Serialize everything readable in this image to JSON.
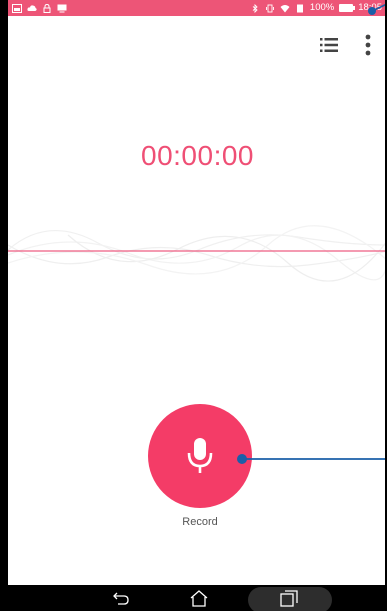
{
  "status_bar": {
    "battery_text": "100%",
    "time": "18:05",
    "color": "#ed5577",
    "icons_left": [
      "gallery-icon",
      "cloud-upload-icon",
      "lock-icon",
      "screen-cast-icon"
    ],
    "icons_right": [
      "bluetooth-icon",
      "vibrate-icon",
      "wifi-icon",
      "battery-icon"
    ]
  },
  "toolbar": {
    "icons": [
      "list-icon",
      "more-vert-icon"
    ]
  },
  "recorder": {
    "timer": "00:00:00",
    "record_label": "Record",
    "accent_color": "#f43c67",
    "timer_color": "#ef4f75"
  },
  "nav_bar": {
    "icons": [
      "back-icon",
      "home-icon",
      "recents-icon"
    ]
  }
}
